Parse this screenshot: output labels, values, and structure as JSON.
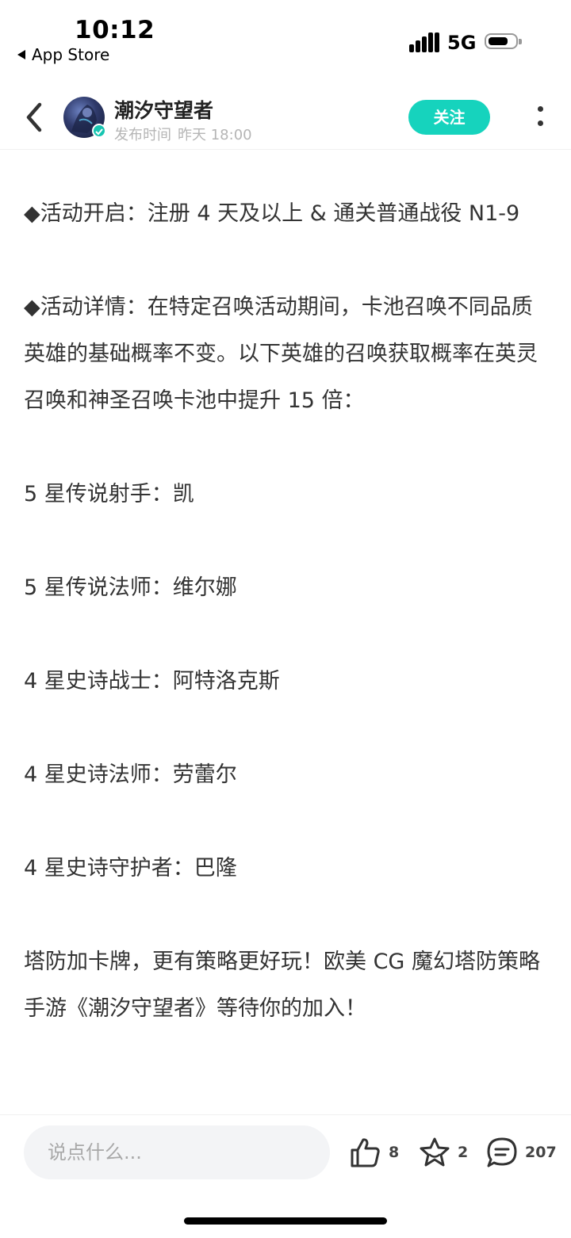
{
  "status_bar": {
    "time": "10:12",
    "back_app_label": "App Store",
    "network": "5G"
  },
  "header": {
    "author_name": "潮汐守望者",
    "publish_label": "发布时间",
    "publish_time": "昨天 18:00",
    "follow_label": "关注"
  },
  "article": {
    "paragraphs": [
      "◆活动开启：注册 4 天及以上 & 通关普通战役 N1-9",
      "◆活动详情：在特定召唤活动期间，卡池召唤不同品质英雄的基础概率不变。以下英雄的召唤获取概率在英灵召唤和神圣召唤卡池中提升 15 倍：",
      "5 星传说射手：凯",
      "5 星传说法师：维尔娜",
      "4 星史诗战士：阿特洛克斯",
      "4 星史诗法师：劳蕾尔",
      "4 星史诗守护者：巴隆",
      "塔防加卡牌，更有策略更好玩！欧美 CG 魔幻塔防策略手游《潮汐守望者》等待你的加入！"
    ]
  },
  "bottom_bar": {
    "comment_placeholder": "说点什么...",
    "like_count": "8",
    "favorite_count": "2",
    "comment_count": "207"
  },
  "colors": {
    "accent": "#16d3bd",
    "text": "#333333",
    "muted": "#b5b5b5"
  },
  "icons": [
    "back-arrow-icon",
    "verified-icon",
    "more-icon",
    "thumbs-up-icon",
    "star-icon",
    "comment-icon"
  ]
}
